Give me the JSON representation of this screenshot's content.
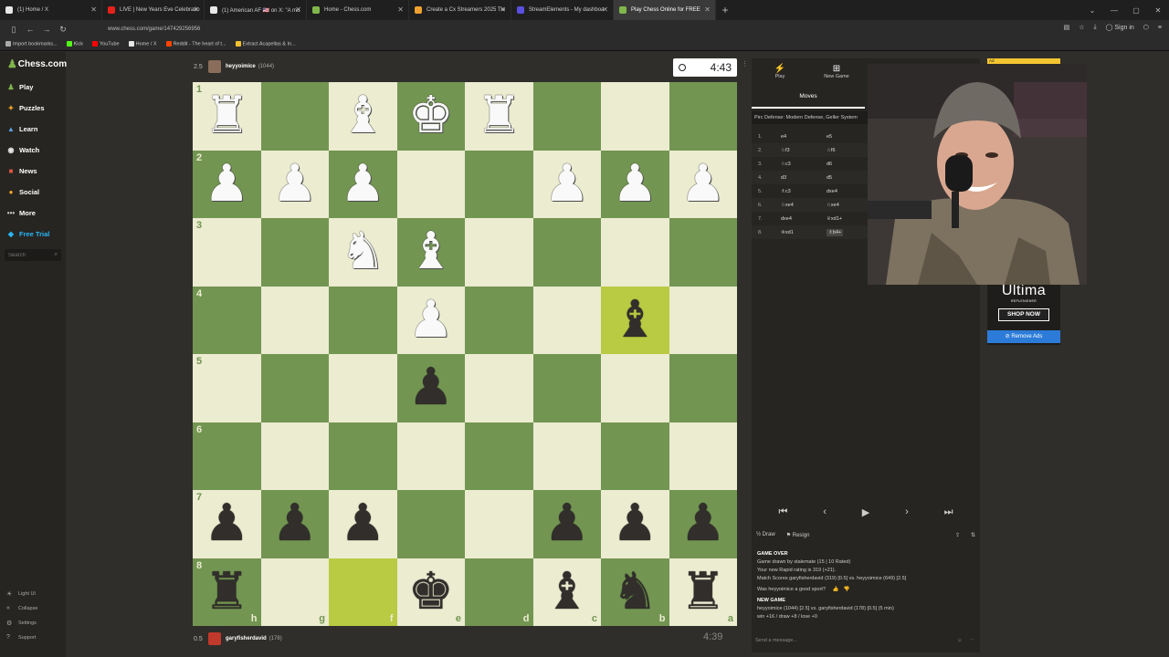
{
  "browser": {
    "tabs": [
      {
        "title": "(1) Home / X",
        "color": "#e7e7e7"
      },
      {
        "title": "LIVE | New Years Eve Celebratio",
        "color": "#e62117"
      },
      {
        "title": "(1) American AF 🇺🇸 on X: \"A mo",
        "color": "#e7e7e7"
      },
      {
        "title": "Home - Chess.com",
        "color": "#81b64c"
      },
      {
        "title": "Create a Cx Streamers 2025 Tie",
        "color": "#f0a030"
      },
      {
        "title": "StreamElements - My dashboa",
        "color": "#5a4fe0"
      },
      {
        "title": "Play Chess Online for FREE",
        "color": "#81b64c"
      }
    ],
    "url": "www.chess.com/game/147429256956",
    "signin": "Sign in",
    "bookmarks": [
      {
        "label": "Import bookmarks...",
        "color": "#aaaaaa"
      },
      {
        "label": "Kick",
        "color": "#53fc18"
      },
      {
        "label": "YouTube",
        "color": "#ff0000"
      },
      {
        "label": "Home / X",
        "color": "#e7e7e7"
      },
      {
        "label": "Reddit - The heart of t...",
        "color": "#ff4500"
      },
      {
        "label": "Extract Acapellas & In...",
        "color": "#f0c030"
      }
    ]
  },
  "sidebar": {
    "logo": "Chess.com",
    "nav": [
      {
        "label": "Play",
        "icon": "♟",
        "color": "#81b64c"
      },
      {
        "label": "Puzzles",
        "icon": "✦",
        "color": "#f5a623"
      },
      {
        "label": "Learn",
        "icon": "▲",
        "color": "#5ca3e6"
      },
      {
        "label": "Watch",
        "icon": "◉",
        "color": "#e8e8e8"
      },
      {
        "label": "News",
        "icon": "■",
        "color": "#e2553f"
      },
      {
        "label": "Social",
        "icon": "●",
        "color": "#f6a829"
      },
      {
        "label": "More",
        "icon": "•••",
        "color": "#ccc"
      },
      {
        "label": "Free Trial",
        "icon": "◆",
        "color": "#29b6f6"
      }
    ],
    "search_placeholder": "Search",
    "bottom": [
      {
        "label": "Light UI",
        "icon": "☀"
      },
      {
        "label": "Collapse",
        "icon": "«"
      },
      {
        "label": "Settings",
        "icon": "⚙"
      },
      {
        "label": "Support",
        "icon": "?"
      }
    ]
  },
  "game": {
    "top_player": {
      "score": "2.5",
      "name": "heyyoimice",
      "rating": "(1044)",
      "clock": "4:43"
    },
    "bottom_player": {
      "score": "0.5",
      "name": "garyfisherdavid",
      "rating": "(178)",
      "clock": "4:39"
    },
    "board": [
      [
        {
          "p": "♜",
          "c": "white"
        },
        {
          "p": "",
          "c": ""
        },
        {
          "p": "♝",
          "c": "white"
        },
        {
          "p": "♚",
          "c": "white"
        },
        {
          "p": "♜",
          "c": "white"
        },
        {
          "p": "",
          "c": ""
        },
        {
          "p": "",
          "c": ""
        },
        {
          "p": "",
          "c": ""
        }
      ],
      [
        {
          "p": "♟",
          "c": "white"
        },
        {
          "p": "♟",
          "c": "white"
        },
        {
          "p": "♟",
          "c": "white"
        },
        {
          "p": "",
          "c": ""
        },
        {
          "p": "",
          "c": ""
        },
        {
          "p": "♟",
          "c": "white"
        },
        {
          "p": "♟",
          "c": "white"
        },
        {
          "p": "♟",
          "c": "white"
        }
      ],
      [
        {
          "p": "",
          "c": ""
        },
        {
          "p": "",
          "c": ""
        },
        {
          "p": "♞",
          "c": "white"
        },
        {
          "p": "♝",
          "c": "white"
        },
        {
          "p": "",
          "c": ""
        },
        {
          "p": "",
          "c": ""
        },
        {
          "p": "",
          "c": ""
        },
        {
          "p": "",
          "c": ""
        }
      ],
      [
        {
          "p": "",
          "c": ""
        },
        {
          "p": "",
          "c": ""
        },
        {
          "p": "",
          "c": ""
        },
        {
          "p": "♟",
          "c": "white"
        },
        {
          "p": "",
          "c": ""
        },
        {
          "p": "",
          "c": ""
        },
        {
          "p": "♝",
          "c": "black"
        },
        {
          "p": "",
          "c": ""
        }
      ],
      [
        {
          "p": "",
          "c": ""
        },
        {
          "p": "",
          "c": ""
        },
        {
          "p": "",
          "c": ""
        },
        {
          "p": "♟",
          "c": "black"
        },
        {
          "p": "",
          "c": ""
        },
        {
          "p": "",
          "c": ""
        },
        {
          "p": "",
          "c": ""
        },
        {
          "p": "",
          "c": ""
        }
      ],
      [
        {
          "p": "",
          "c": ""
        },
        {
          "p": "",
          "c": ""
        },
        {
          "p": "",
          "c": ""
        },
        {
          "p": "",
          "c": ""
        },
        {
          "p": "",
          "c": ""
        },
        {
          "p": "",
          "c": ""
        },
        {
          "p": "",
          "c": ""
        },
        {
          "p": "",
          "c": ""
        }
      ],
      [
        {
          "p": "♟",
          "c": "black"
        },
        {
          "p": "♟",
          "c": "black"
        },
        {
          "p": "♟",
          "c": "black"
        },
        {
          "p": "",
          "c": ""
        },
        {
          "p": "",
          "c": ""
        },
        {
          "p": "♟",
          "c": "black"
        },
        {
          "p": "♟",
          "c": "black"
        },
        {
          "p": "♟",
          "c": "black"
        }
      ],
      [
        {
          "p": "♜",
          "c": "black"
        },
        {
          "p": "",
          "c": ""
        },
        {
          "p": "",
          "c": ""
        },
        {
          "p": "♚",
          "c": "black"
        },
        {
          "p": "",
          "c": ""
        },
        {
          "p": "♝",
          "c": "black"
        },
        {
          "p": "♞",
          "c": "black"
        },
        {
          "p": "♜",
          "c": "black"
        }
      ]
    ],
    "ranks": [
      "1",
      "2",
      "3",
      "4",
      "5",
      "6",
      "7",
      "8"
    ],
    "files": [
      "h",
      "g",
      "f",
      "e",
      "d",
      "c",
      "b",
      "a"
    ],
    "highlight": [
      [
        3,
        6
      ],
      [
        7,
        2
      ]
    ],
    "colors": {
      "light": "#ebecd0",
      "dark": "#739552"
    }
  },
  "panel": {
    "tabs": [
      {
        "label": "Play",
        "icon": "⚡"
      },
      {
        "label": "New Game",
        "icon": "⊞"
      }
    ],
    "moves_tab": "Moves",
    "opening": "Pirc Defense: Modern Defense, Geller System",
    "moves": [
      {
        "n": "1.",
        "w": "e4",
        "b": "e5"
      },
      {
        "n": "2.",
        "w": "♘f3",
        "b": "♘f6"
      },
      {
        "n": "3.",
        "w": "♘c3",
        "b": "d6"
      },
      {
        "n": "4.",
        "w": "d3",
        "b": "d5"
      },
      {
        "n": "5.",
        "w": "♗c3",
        "b": "dxe4"
      },
      {
        "n": "6.",
        "w": "♘xe4",
        "b": "♘xe4"
      },
      {
        "n": "7.",
        "w": "dxe4",
        "b": "♕xd1+"
      },
      {
        "n": "8.",
        "w": "♔xd1",
        "b": "♗b4+"
      }
    ],
    "draw": "Draw",
    "resign": "Resign",
    "gameover_title": "GAME OVER",
    "gameover_lines": [
      "Game drawn by stalemate (15 | 10 Rated)",
      "Your new Rapid rating is 319 (+21).",
      "Match Scores garyfisherdavid (319) [0.5] vs. heyyoimice (649) [2.5]"
    ],
    "good_sport": "Was heyyoimice a good sport?",
    "newgame_title": "NEW GAME",
    "newgame_lines": [
      "heyyoimice (1044) [2.5] vs. garyfisherdavid (178) [0.5] (5 min)",
      "win +16 / draw +8 / lose +0"
    ],
    "chat_placeholder": "Send a message..."
  },
  "ad": {
    "label": "Ad",
    "brand": "Ultima",
    "brand_sub": "REPLENISHER",
    "shop": "SHOP NOW",
    "remove": "Remove Ads"
  }
}
